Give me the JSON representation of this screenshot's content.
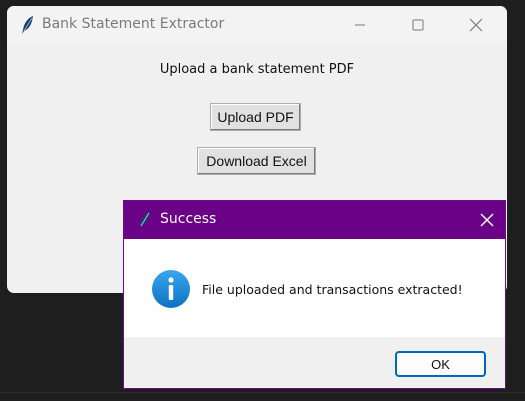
{
  "main_window": {
    "title": "Bank Statement Extractor",
    "prompt_label": "Upload a bank statement PDF",
    "upload_button": "Upload PDF",
    "download_button": "Download Excel"
  },
  "dialog": {
    "title": "Success",
    "message": "File uploaded and transactions extracted!",
    "ok_button": "OK",
    "icon": "info-icon"
  },
  "colors": {
    "dialog_titlebar": "#6a0187",
    "info_icon": "#1e8fd9",
    "ok_border": "#0067c0"
  }
}
